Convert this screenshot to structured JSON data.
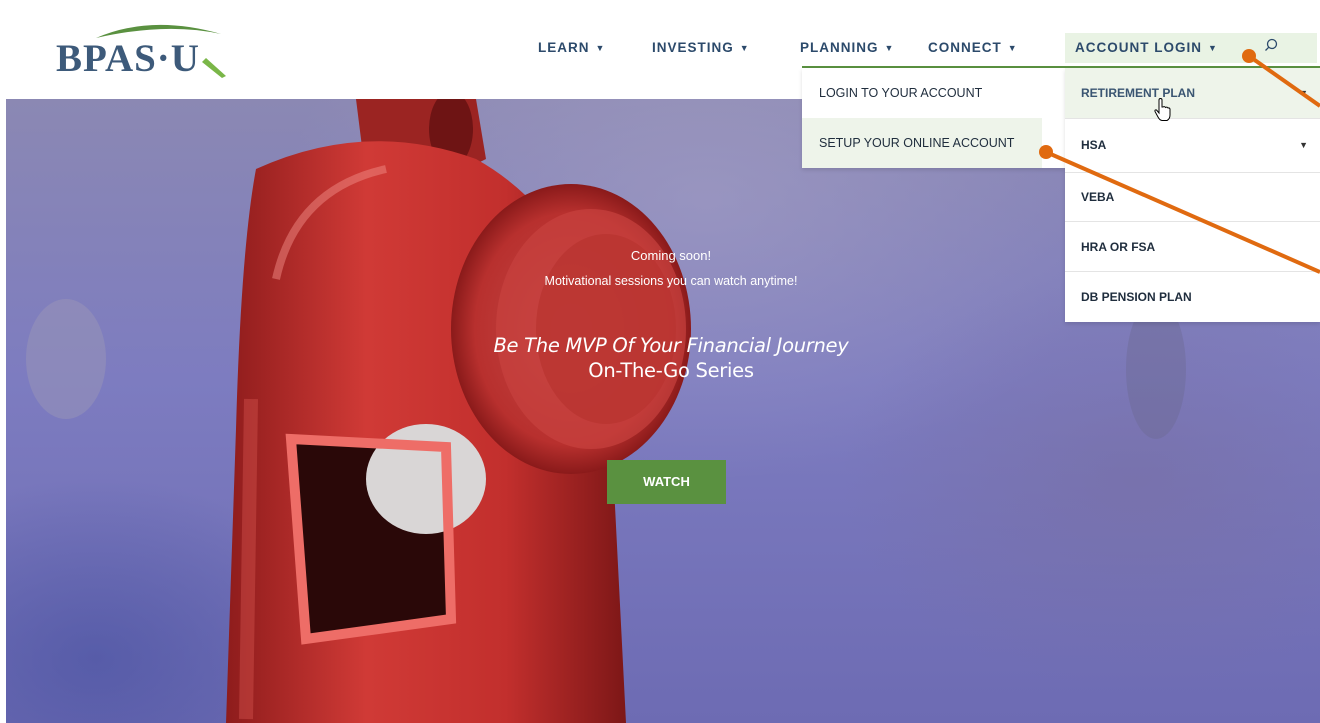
{
  "brand": {
    "logo_text": "BPAS·U",
    "colors": {
      "navy": "#2c4a6b",
      "green": "#5a9140",
      "annotation": "#e06a10"
    }
  },
  "nav": {
    "items": [
      {
        "label": "LEARN"
      },
      {
        "label": "INVESTING"
      },
      {
        "label": "PLANNING"
      },
      {
        "label": "CONNECT"
      },
      {
        "label": "ACCOUNT LOGIN"
      }
    ],
    "search_icon": "search-icon"
  },
  "connect_menu": {
    "items": [
      {
        "label": "LOGIN TO YOUR ACCOUNT"
      },
      {
        "label": "SETUP YOUR ONLINE ACCOUNT"
      }
    ]
  },
  "login_menu": {
    "items": [
      {
        "label": "RETIREMENT PLAN",
        "has_submenu": true,
        "hovered": true
      },
      {
        "label": "HSA",
        "has_submenu": true
      },
      {
        "label": "VEBA"
      },
      {
        "label": "HRA OR FSA"
      },
      {
        "label": "DB PENSION PLAN"
      }
    ]
  },
  "hero": {
    "coming": "Coming soon!",
    "motivation": "Motivational sessions you can watch anytime!",
    "tagline": "Be The MVP Of Your Financial Journey",
    "series": "On-The-Go Series",
    "button": "WATCH"
  }
}
